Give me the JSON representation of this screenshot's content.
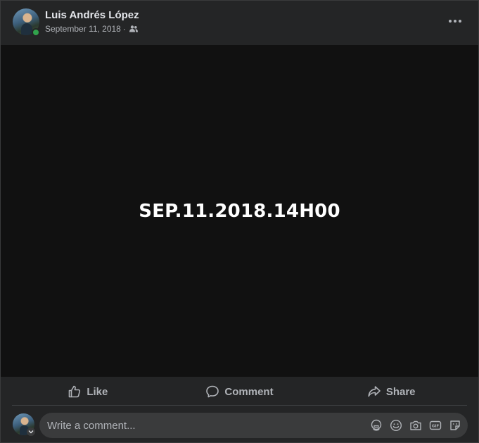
{
  "post": {
    "author_name": "Luis Andrés López",
    "date": "September 11, 2018",
    "separator": "·",
    "audience_icon": "friends-icon",
    "more_icon": "more-options-icon",
    "media_text": "SEP.11.2018.14H00"
  },
  "actions": {
    "like_label": "Like",
    "comment_label": "Comment",
    "share_label": "Share"
  },
  "comment": {
    "placeholder": "Write a comment...",
    "tools": [
      "avatar-sticker-icon",
      "emoji-icon",
      "camera-icon",
      "gif-icon",
      "sticker-icon"
    ]
  },
  "colors": {
    "card_bg": "#242526",
    "media_bg": "#111111",
    "text_primary": "#e4e6eb",
    "text_secondary": "#b0b3b8",
    "online": "#31a24c"
  }
}
